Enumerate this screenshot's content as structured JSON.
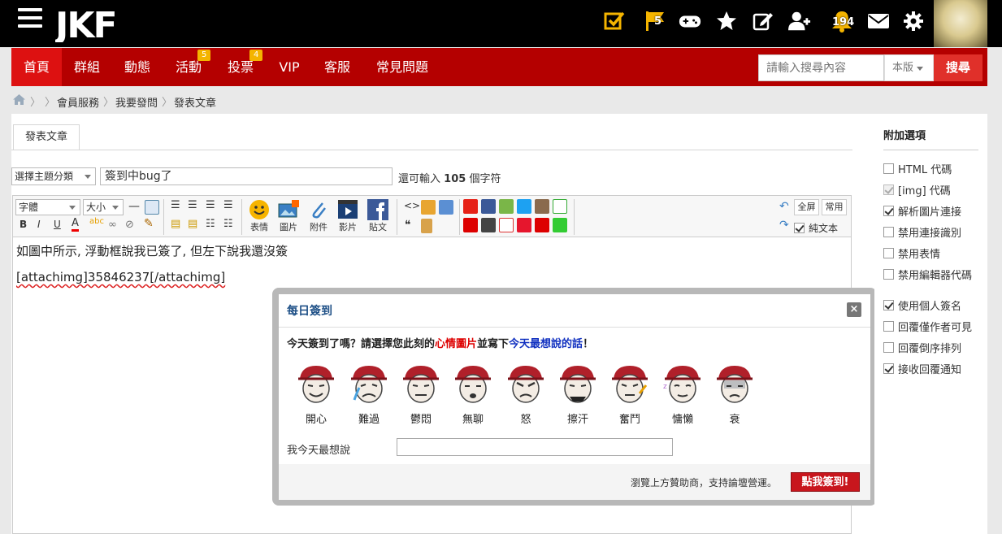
{
  "header": {
    "logo_text": "JKF",
    "flag_count": "5",
    "notification_count": "194"
  },
  "nav": {
    "items": [
      {
        "label": "首頁",
        "active": true
      },
      {
        "label": "群組"
      },
      {
        "label": "動態"
      },
      {
        "label": "活動",
        "badge": "5"
      },
      {
        "label": "投票",
        "badge": "4"
      },
      {
        "label": "VIP"
      },
      {
        "label": "客服"
      },
      {
        "label": "常見問題"
      }
    ],
    "search_placeholder": "請輸入搜尋內容",
    "search_scope": "本版",
    "search_button": "搜尋"
  },
  "breadcrumb": [
    "會員服務",
    "我要發問",
    "發表文章"
  ],
  "post": {
    "tab_label": "發表文章",
    "category_select": "選擇主題分類",
    "title_value": "簽到中bug了",
    "remaining_prefix": "還可輸入",
    "remaining_count": "105",
    "remaining_suffix": "個字符"
  },
  "toolbar": {
    "font_select": "字體",
    "size_select": "大小",
    "emoticon": "表情",
    "image": "圖片",
    "attachment": "附件",
    "video": "影片",
    "post_fb": "貼文",
    "fullscreen": "全屏",
    "common": "常用",
    "plain_text": "純文本"
  },
  "editor": {
    "line1": "如圖中所示, 浮動框說我已簽了, 但左下說我還沒簽",
    "line2": "[attachimg]35846237[/attachimg]"
  },
  "modal": {
    "title": "每日簽到",
    "close": "×",
    "question_a": "今天簽到了嗎？請選擇您此刻的",
    "question_red": "心情圖片",
    "question_b": "並寫下",
    "question_blue": "今天最想說的話",
    "question_c": "！",
    "moods": [
      "開心",
      "難過",
      "鬱悶",
      "無聊",
      "怒",
      "擦汗",
      "奮鬥",
      "慵懶",
      "衰"
    ],
    "say_label": "我今天最想說",
    "say_value": "",
    "footer_text": "瀏覽上方贊助商，支持論壇營運。",
    "checkin_button": "點我簽到!"
  },
  "sidebar": {
    "title": "附加選項",
    "options": [
      {
        "label": "HTML 代碼",
        "checked": false
      },
      {
        "label": "[img] 代碼",
        "checked": true,
        "disabled": true
      },
      {
        "label": "解析圖片連接",
        "checked": true
      },
      {
        "label": "禁用連接識別",
        "checked": false
      },
      {
        "label": "禁用表情",
        "checked": false
      },
      {
        "label": "禁用編輯器代碼",
        "checked": false
      },
      {
        "label": "使用個人簽名",
        "checked": true
      },
      {
        "label": "回覆僅作者可見",
        "checked": false
      },
      {
        "label": "回覆倒序排列",
        "checked": false
      },
      {
        "label": "接收回覆通知",
        "checked": true
      }
    ]
  },
  "colors": {
    "nav_bg": "#b40000",
    "nav_active": "#dd1111",
    "search_button": "#e0302a",
    "checkin_button": "#c8161d",
    "modal_title": "#1d4f86"
  }
}
